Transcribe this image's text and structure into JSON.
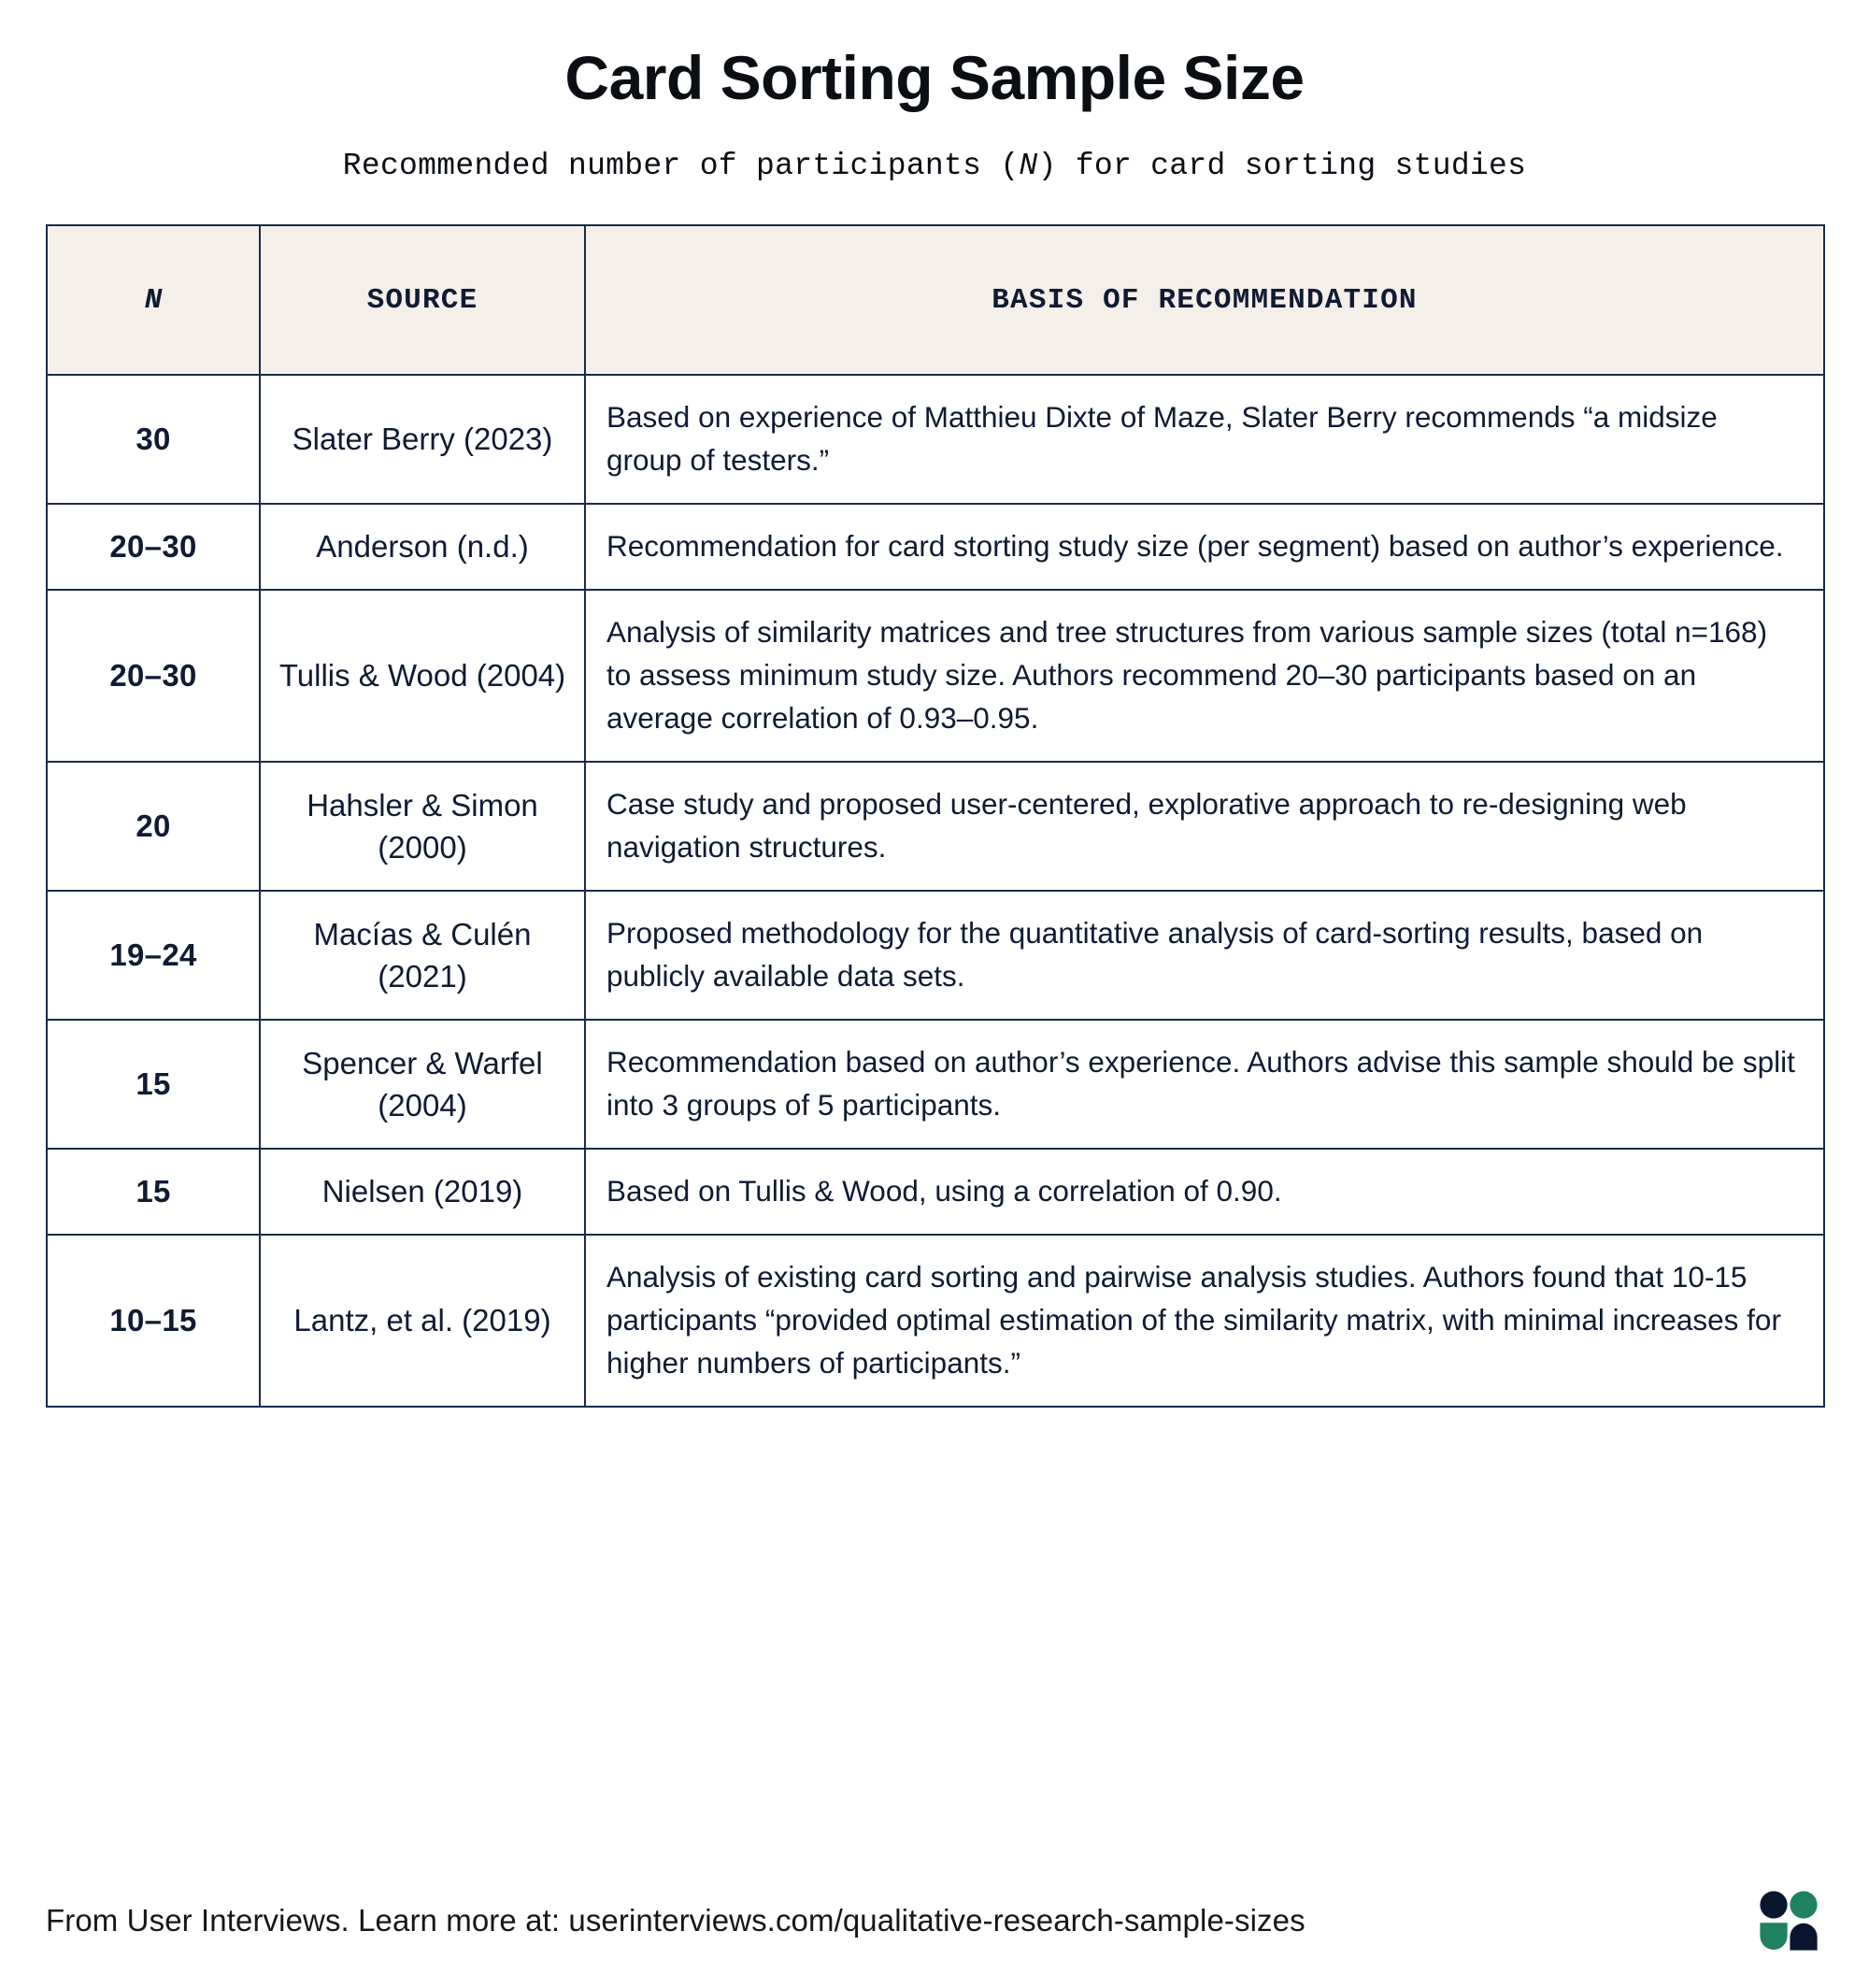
{
  "header": {
    "title": "Card Sorting Sample Size",
    "subtitle_before": "Recommended number of participants (",
    "subtitle_n": "N",
    "subtitle_after": ") for card sorting studies"
  },
  "table": {
    "columns": [
      {
        "key": "n",
        "label": "N"
      },
      {
        "key": "source",
        "label": "SOURCE"
      },
      {
        "key": "basis",
        "label": "BASIS OF RECOMMENDATION"
      }
    ],
    "rows": [
      {
        "n": "30",
        "source": "Slater Berry (2023)",
        "basis": "Based on experience of Matthieu Dixte of Maze, Slater Berry recommends “a midsize group of testers.”"
      },
      {
        "n": "20–30",
        "source": "Anderson (n.d.)",
        "basis": "Recommendation for card storting study size (per segment) based on author’s experience."
      },
      {
        "n": "20–30",
        "source": "Tullis & Wood (2004)",
        "basis": "Analysis of similarity matrices and tree structures from various sample sizes (total n=168) to assess minimum study size. Authors recommend 20–30 participants based on an average correlation of 0.93–0.95."
      },
      {
        "n": "20",
        "source": "Hahsler & Simon (2000)",
        "basis": "Case study and proposed user-centered, explorative approach to re-designing web navigation structures."
      },
      {
        "n": "19–24",
        "source": "Macías & Culén (2021)",
        "basis": "Proposed methodology for the quantitative analysis of card-sorting results, based on publicly available data sets."
      },
      {
        "n": "15",
        "source": "Spencer & Warfel (2004)",
        "basis": "Recommendation based on author’s experience. Authors advise this sample should be split into 3 groups of 5 participants."
      },
      {
        "n": "15",
        "source": "Nielsen (2019)",
        "basis": "Based on Tullis & Wood, using a correlation of 0.90."
      },
      {
        "n": "10–15",
        "source": "Lantz, et al. (2019)",
        "basis": "Analysis of existing card sorting and pairwise analysis studies. Authors found that 10-15 participants “provided optimal estimation of the similarity matrix, with minimal increases for higher numbers of participants.”"
      }
    ]
  },
  "footer": {
    "text": "From User Interviews. Learn more at: userinterviews.com/qualitative-research-sample-sizes",
    "logo_navy": "#0a1630",
    "logo_green": "#1f8162"
  }
}
